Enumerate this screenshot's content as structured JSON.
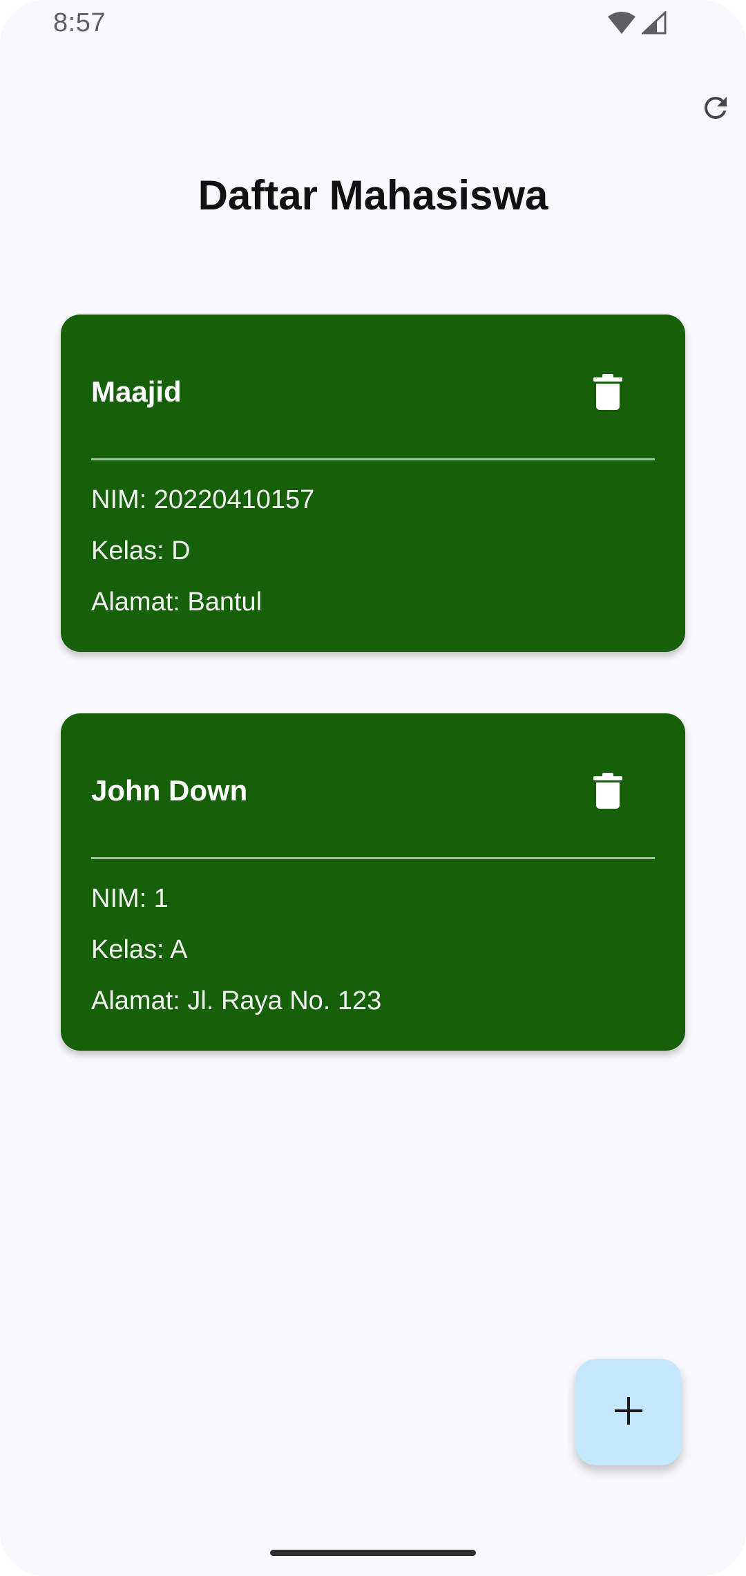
{
  "status_bar": {
    "time": "8:57",
    "icons": [
      "wifi-icon",
      "cell-signal-icon"
    ]
  },
  "header": {
    "title": "Daftar Mahasiswa",
    "refresh_icon": "refresh-icon"
  },
  "students": [
    {
      "name": "Maajid",
      "nim": "NIM: 20220410157",
      "kelas": "Kelas: D",
      "alamat": "Alamat: Bantul",
      "delete_icon": "trash-icon"
    },
    {
      "name": "John Down",
      "nim": "NIM: 1",
      "kelas": "Kelas: A",
      "alamat": "Alamat: Jl. Raya No. 123",
      "delete_icon": "trash-icon"
    }
  ],
  "fab": {
    "icon": "plus-icon"
  },
  "colors": {
    "card_background": "#17600a",
    "fab_background": "#c4e7fb",
    "screen_background": "#f9f8fc"
  }
}
